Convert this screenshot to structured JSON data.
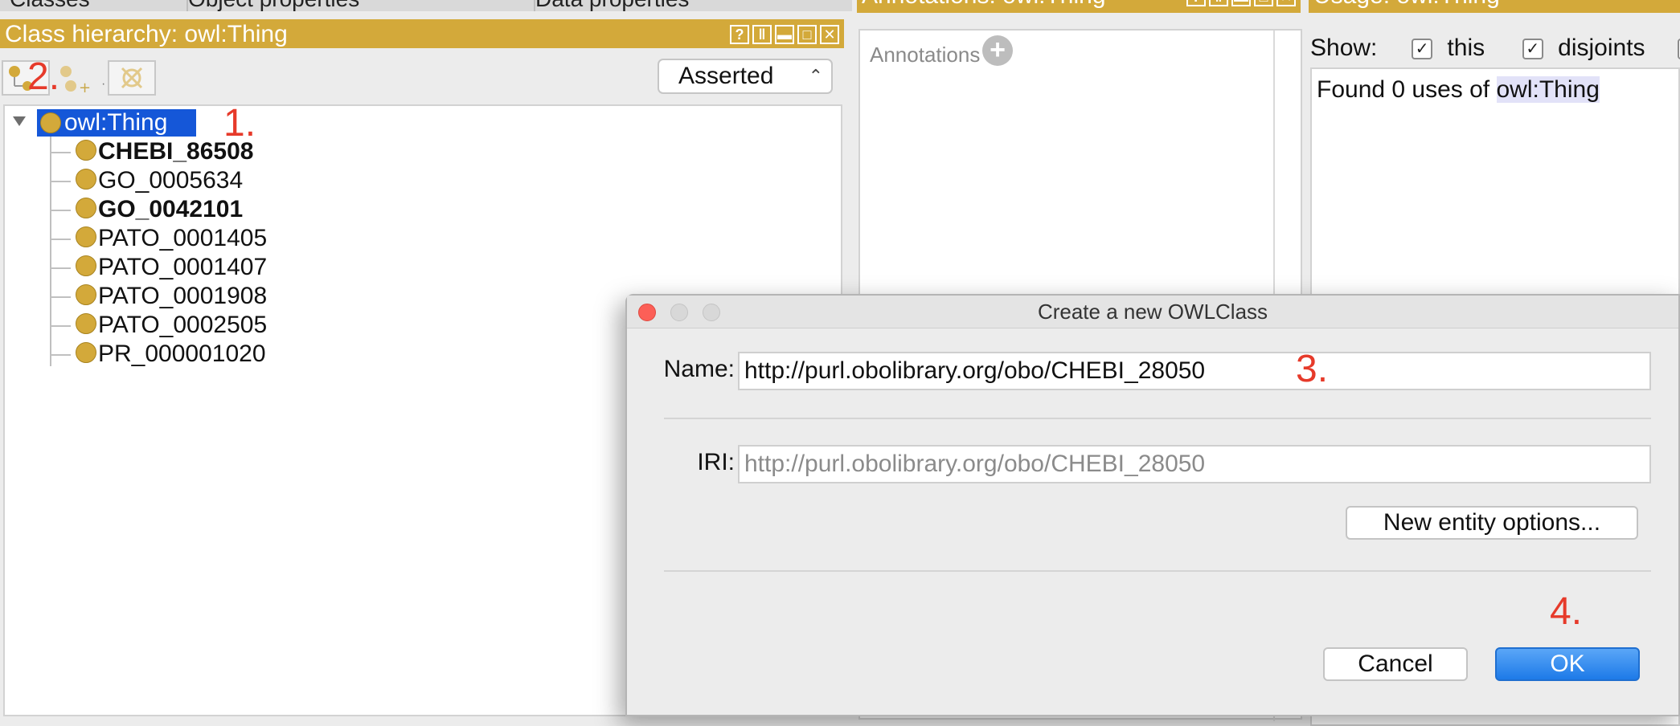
{
  "tabs": [
    "Classes",
    "Object properties",
    "Data properties"
  ],
  "class_hierarchy": {
    "title": "Class hierarchy: owl:Thing",
    "view_mode": "Asserted",
    "root": "owl:Thing",
    "children": [
      {
        "label": "CHEBI_86508",
        "bold": true
      },
      {
        "label": "GO_0005634",
        "bold": false
      },
      {
        "label": "GO_0042101",
        "bold": true
      },
      {
        "label": "PATO_0001405",
        "bold": false
      },
      {
        "label": "PATO_0001407",
        "bold": false
      },
      {
        "label": "PATO_0001908",
        "bold": false
      },
      {
        "label": "PATO_0002505",
        "bold": false
      },
      {
        "label": "PR_000001020",
        "bold": false
      }
    ]
  },
  "annotations": {
    "title": "Annotations: owl:Thing",
    "section_label": "Annotations"
  },
  "usage": {
    "title": "Usage: owl:Thing",
    "show_label": "Show:",
    "options": [
      {
        "label": "this",
        "checked": true
      },
      {
        "label": "disjoints",
        "checked": true
      },
      {
        "label": "",
        "checked": true
      }
    ],
    "result_prefix": "Found 0 uses of",
    "result_entity": "owl:Thing"
  },
  "dialog": {
    "title": "Create a new OWLClass",
    "name_label": "Name:",
    "name_value": "http://purl.obolibrary.org/obo/CHEBI_28050",
    "iri_label": "IRI:",
    "iri_value": "http://purl.obolibrary.org/obo/CHEBI_28050",
    "options_button": "New entity options...",
    "cancel_button": "Cancel",
    "ok_button": "OK"
  },
  "step_markers": [
    "1.",
    "2.",
    "3.",
    "4."
  ],
  "colors": {
    "header_gold": "#d3a93a",
    "selection_blue": "#1557d8",
    "marker_red": "#e63a2a",
    "ok_blue": "#2d8cf0"
  }
}
